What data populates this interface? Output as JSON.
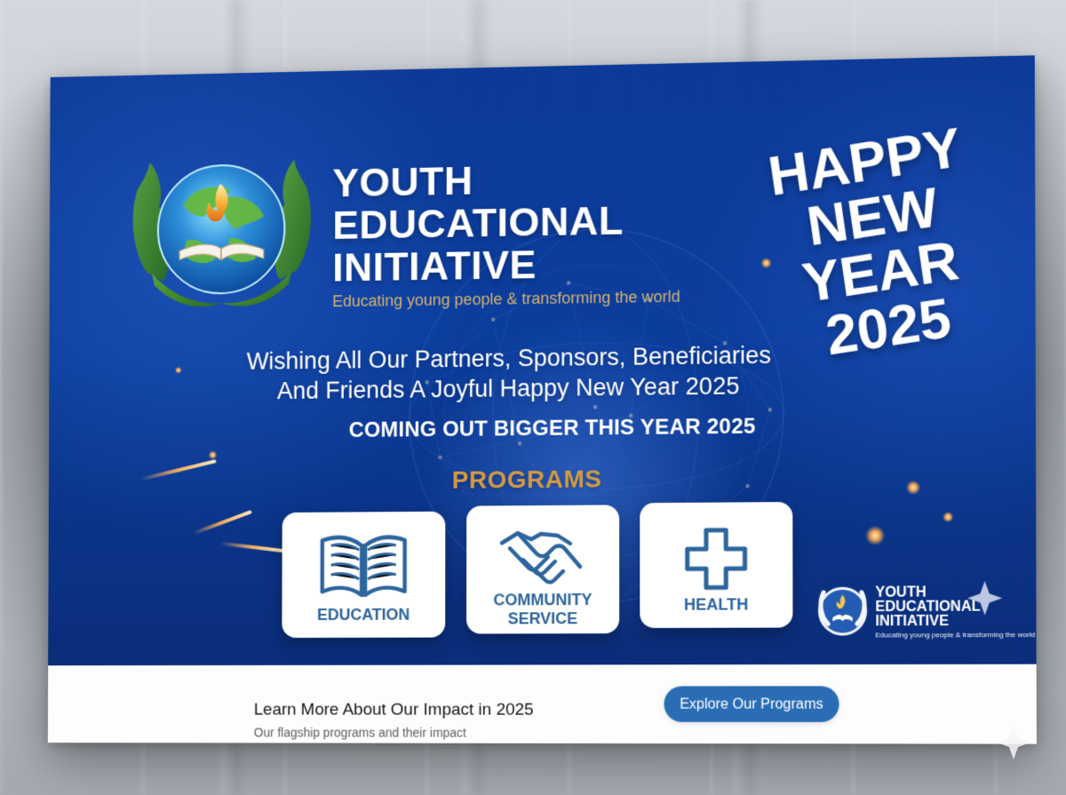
{
  "brand": {
    "lines": [
      "YOUTH",
      "EDUCATIONAL",
      "INITIATIVE"
    ],
    "tagline": "Educating young people & transforming the world"
  },
  "headline": {
    "lines": [
      "HAPPY",
      "NEW",
      "YEAR",
      "2025"
    ]
  },
  "message": {
    "line1": "Wishing All Our Partners, Sponsors, Beneficiaries",
    "line2": "And Friends A Joyful Happy New Year 2025",
    "coming_out": "COMING OUT BIGGER THIS YEAR 2025"
  },
  "programs": {
    "title": "PROGRAMS",
    "items": [
      {
        "label": "EDUCATION",
        "icon": "book-icon"
      },
      {
        "label_line1": "COMMUNITY",
        "label_line2": "SERVICE",
        "icon": "handshake-icon"
      },
      {
        "label": "HEALTH",
        "icon": "plus-icon"
      }
    ]
  },
  "mini_brand": {
    "lines": [
      "YOUTH",
      "EDUCATIONAL",
      "INITIATIVE"
    ],
    "tagline": "Educating young people & transforming the world"
  },
  "footer": {
    "title": "Learn More About Our Impact in 2025",
    "subtitle": "Our flagship programs and their impact",
    "button": "Explore Our Programs"
  },
  "colors": {
    "hero_blue": "#0d3b8f",
    "accent_gold": "#d39a45",
    "card_blue": "#2d659d",
    "button_blue": "#2a6db5"
  }
}
